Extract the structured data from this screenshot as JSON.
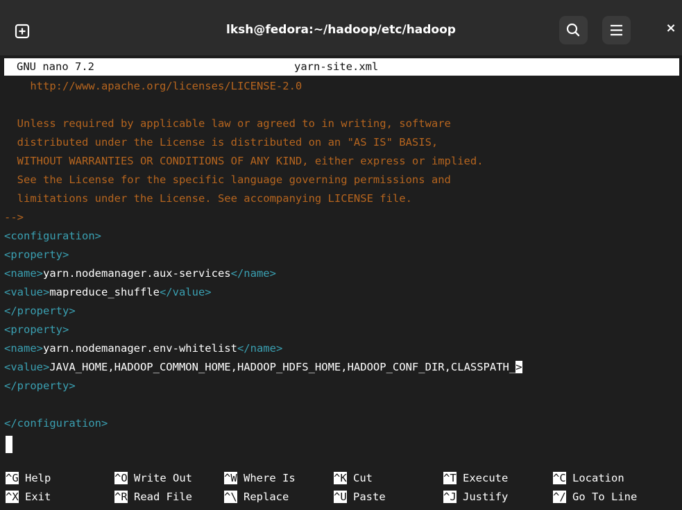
{
  "window": {
    "title": "lksh@fedora:~/hadoop/etc/hadoop",
    "close_glyph": "×",
    "icons": [
      "new-tab-icon",
      "search-icon",
      "hamburger-menu-icon",
      "close-icon"
    ]
  },
  "nano": {
    "version": "GNU nano 7.2",
    "filename": "yarn-site.xml"
  },
  "file": {
    "comment_lines": [
      "    http://www.apache.org/licenses/LICENSE-2.0",
      "",
      "  Unless required by applicable law or agreed to in writing, software",
      "  distributed under the License is distributed on an \"AS IS\" BASIS,",
      "  WITHOUT WARRANTIES OR CONDITIONS OF ANY KIND, either express or implied.",
      "  See the License for the specific language governing permissions and",
      "  limitations under the License. See accompanying LICENSE file.",
      "-->"
    ],
    "config_open": "<configuration>",
    "prop1_open": "<property>",
    "prop1_name_open": "<name>",
    "prop1_name_value": "yarn.nodemanager.aux-services",
    "prop1_name_close": "</name>",
    "prop1_value_open": "<value>",
    "prop1_value_value": "mapreduce_shuffle",
    "prop1_value_close": "</value>",
    "prop1_close": "</property>",
    "prop2_open": "<property>",
    "prop2_name_open": "<name>",
    "prop2_name_value": "yarn.nodemanager.env-whitelist",
    "prop2_name_close": "</name>",
    "prop2_value_open": "<value>",
    "prop2_value_value": "JAVA_HOME,HADOOP_COMMON_HOME,HADOOP_HDFS_HOME,HADOOP_CONF_DIR,CLASSPATH_",
    "overflow_marker": ">",
    "prop2_close": "</property>",
    "config_close": "</configuration>"
  },
  "shortcuts": {
    "row1": [
      {
        "key": "^G",
        "label": "Help"
      },
      {
        "key": "^O",
        "label": "Write Out"
      },
      {
        "key": "^W",
        "label": "Where Is"
      },
      {
        "key": "^K",
        "label": "Cut"
      },
      {
        "key": "^T",
        "label": "Execute"
      },
      {
        "key": "^C",
        "label": "Location"
      }
    ],
    "row2": [
      {
        "key": "^X",
        "label": "Exit"
      },
      {
        "key": "^R",
        "label": "Read File"
      },
      {
        "key": "^\\",
        "label": "Replace"
      },
      {
        "key": "^U",
        "label": "Paste"
      },
      {
        "key": "^J",
        "label": "Justify"
      },
      {
        "key": "^/",
        "label": "Go To Line"
      }
    ]
  },
  "colors": {
    "background": "#1e1e1e",
    "titlebar": "#2c2c2c",
    "comment": "#b6651e",
    "tag": "#3aa0b2",
    "text": "#ffffff"
  }
}
